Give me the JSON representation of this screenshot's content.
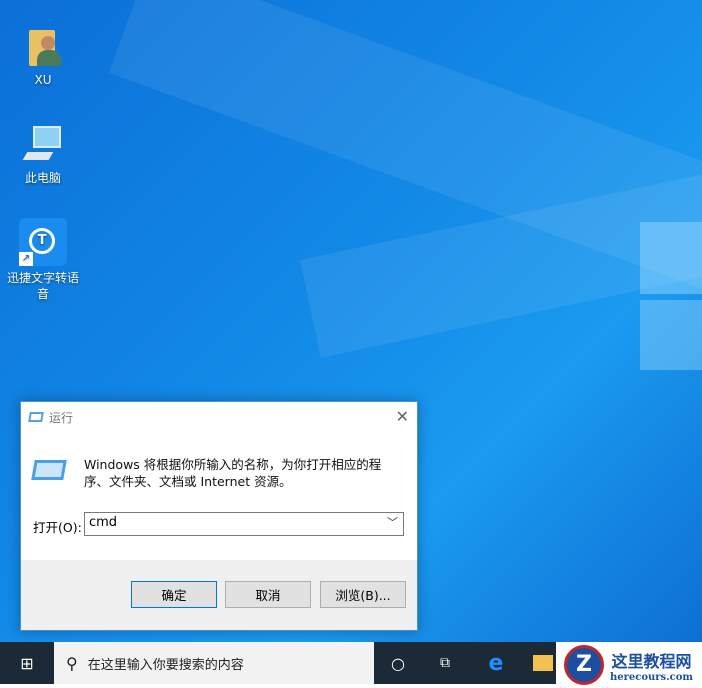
{
  "desktop": {
    "icons": [
      {
        "label": "XU",
        "icon": "user-folder-icon"
      },
      {
        "label": "此电脑",
        "icon": "computer-icon"
      },
      {
        "label": "迅捷文字转语音",
        "icon": "app-shortcut-icon"
      }
    ]
  },
  "run_dialog": {
    "title": "运行",
    "message": "Windows 将根据你所输入的名称，为你打开相应的程序、文件夹、文档或 Internet 资源。",
    "open_label": "打开(O):",
    "input_value": "cmd",
    "ok": "确定",
    "cancel": "取消",
    "browse": "浏览(B)..."
  },
  "taskbar": {
    "search_placeholder": "在这里输入你要搜索的内容"
  },
  "watermark": {
    "title": "这里教程网",
    "url": "herecours.com"
  },
  "colors": {
    "accent": "#0e7ad8",
    "taskbar": "#1b2a36"
  }
}
